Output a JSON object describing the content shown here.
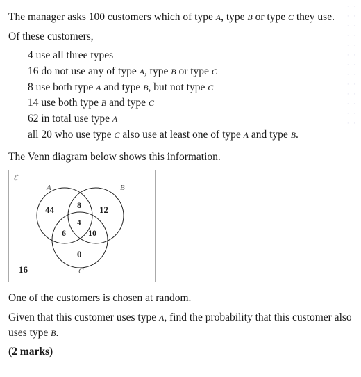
{
  "intro": {
    "line1a": "The manager asks 100 customers which of type ",
    "A": "A",
    "line1b": ", type ",
    "B": "B",
    "line1c": " or type ",
    "C": "C",
    "line1d": " they use."
  },
  "of_these": "Of these customers,",
  "bullets": {
    "b1": "4 use all three types",
    "b2a": "16 do not use any of type ",
    "b2b": ", type ",
    "b2c": " or type ",
    "b3a": "8 use both type ",
    "b3b": " and type ",
    "b3c": ", but not type ",
    "b4a": "14 use both type ",
    "b4b": " and type ",
    "b5a": "62 in total use type ",
    "b6a": "all 20 who use type ",
    "b6b": " also use at least one of type ",
    "b6c": " and type ",
    "b6d": "."
  },
  "venn_caption": "The Venn diagram below shows this information.",
  "chart_data": {
    "type": "venn",
    "sets": [
      "A",
      "B",
      "C"
    ],
    "regions": {
      "A_only": 44,
      "B_only": 12,
      "C_only": 0,
      "A_and_B_only": 8,
      "A_and_C_only": 6,
      "B_and_C_only": 10,
      "A_B_C": 4,
      "outside": 16
    },
    "universe_label": "ℰ"
  },
  "q1": "One of the customers is chosen at random.",
  "q2a": "Given that this customer uses type ",
  "q2b": ", find the probability that this customer also uses type ",
  "q2c": ".",
  "marks": "(2 marks)"
}
